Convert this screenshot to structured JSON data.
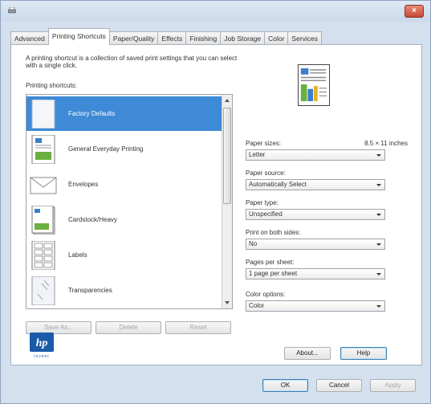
{
  "window": {
    "close_label": "×"
  },
  "tabs": [
    {
      "label": "Advanced"
    },
    {
      "label": "Printing Shortcuts"
    },
    {
      "label": "Paper/Quality"
    },
    {
      "label": "Effects"
    },
    {
      "label": "Finishing"
    },
    {
      "label": "Job Storage"
    },
    {
      "label": "Color"
    },
    {
      "label": "Services"
    }
  ],
  "active_tab": "Printing Shortcuts",
  "panel": {
    "description_line1": "A printing shortcut is a collection of saved print settings that you can select",
    "description_line2": "with a single click.",
    "shortcuts_label": "Printing shortcuts:",
    "shortcuts": [
      {
        "label": "Factory Defaults",
        "icon": "blank-page-icon"
      },
      {
        "label": "General Everyday Printing",
        "icon": "document-page-icon"
      },
      {
        "label": "Envelopes",
        "icon": "envelope-icon"
      },
      {
        "label": "Cardstock/Heavy",
        "icon": "cardstock-icon"
      },
      {
        "label": "Labels",
        "icon": "labels-sheet-icon"
      },
      {
        "label": "Transparencies",
        "icon": "transparency-icon"
      }
    ],
    "selected_shortcut": "Factory Defaults",
    "save_as_label": "Save As...",
    "delete_label": "Delete",
    "reset_label": "Reset",
    "paper_sizes_label": "Paper sizes:",
    "paper_sizes_dimensions": "8.5 × 11 inches",
    "paper_size_value": "Letter",
    "paper_source_label": "Paper source:",
    "paper_source_value": "Automatically Select",
    "paper_type_label": "Paper type:",
    "paper_type_value": "Unspecified",
    "print_both_sides_label": "Print on both sides:",
    "print_both_sides_value": "No",
    "pages_per_sheet_label": "Pages per sheet:",
    "pages_per_sheet_value": "1 page per sheet",
    "color_options_label": "Color options:",
    "color_options_value": "Color",
    "about_label": "About...",
    "help_label": "Help",
    "logo_text": "hp",
    "logo_subtext": "invent"
  },
  "footer": {
    "ok_label": "OK",
    "cancel_label": "Cancel",
    "apply_label": "Apply"
  },
  "colors": {
    "selection": "#3e8ad6",
    "window_frame": "#d4e0ee",
    "close_button": "#c44a33",
    "hp_blue": "#1a5aa8"
  }
}
